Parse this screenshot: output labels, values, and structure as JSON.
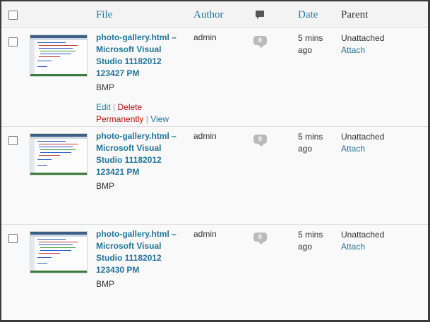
{
  "header": {
    "file": "File",
    "author": "Author",
    "comments_icon": "comment-bubble",
    "date": "Date",
    "parent": "Parent"
  },
  "rows": [
    {
      "title": "photo-gallery.html – Microsoft Visual Studio 11182012 123427 PM",
      "type": "BMP",
      "author": "admin",
      "comments": "0",
      "date_line1": "5 mins",
      "date_line2": "ago",
      "parent": "Unattached",
      "attach": "Attach",
      "actions": {
        "edit": "Edit",
        "sep1": "|",
        "delete": "Delete Permanently",
        "sep2": "|",
        "view": "View"
      }
    },
    {
      "title": "photo-gallery.html – Microsoft Visual Studio 11182012 123421 PM",
      "type": "BMP",
      "author": "admin",
      "comments": "0",
      "date_line1": "5 mins",
      "date_line2": "ago",
      "parent": "Unattached",
      "attach": "Attach"
    },
    {
      "title": "photo-gallery.html – Microsoft Visual Studio 11182012 123430 PM",
      "type": "BMP",
      "author": "admin",
      "comments": "0",
      "date_line1": "5 mins",
      "date_line2": "ago",
      "parent": "Unattached",
      "attach": "Attach"
    }
  ],
  "colors": {
    "link": "#21759b",
    "delete": "#bc0b0b",
    "bubble": "#bbbbbb"
  }
}
